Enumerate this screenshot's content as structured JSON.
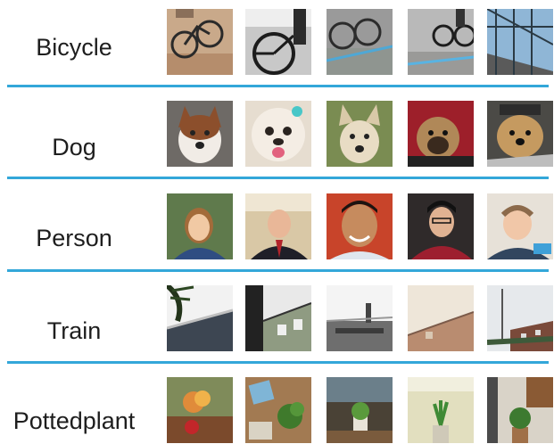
{
  "rows": [
    {
      "label": "Bicycle"
    },
    {
      "label": "Dog"
    },
    {
      "label": "Person"
    },
    {
      "label": "Train"
    },
    {
      "label": "Pottedplant"
    }
  ],
  "colors": {
    "divider": "#33a7d9",
    "text": "#1e1e1e"
  }
}
